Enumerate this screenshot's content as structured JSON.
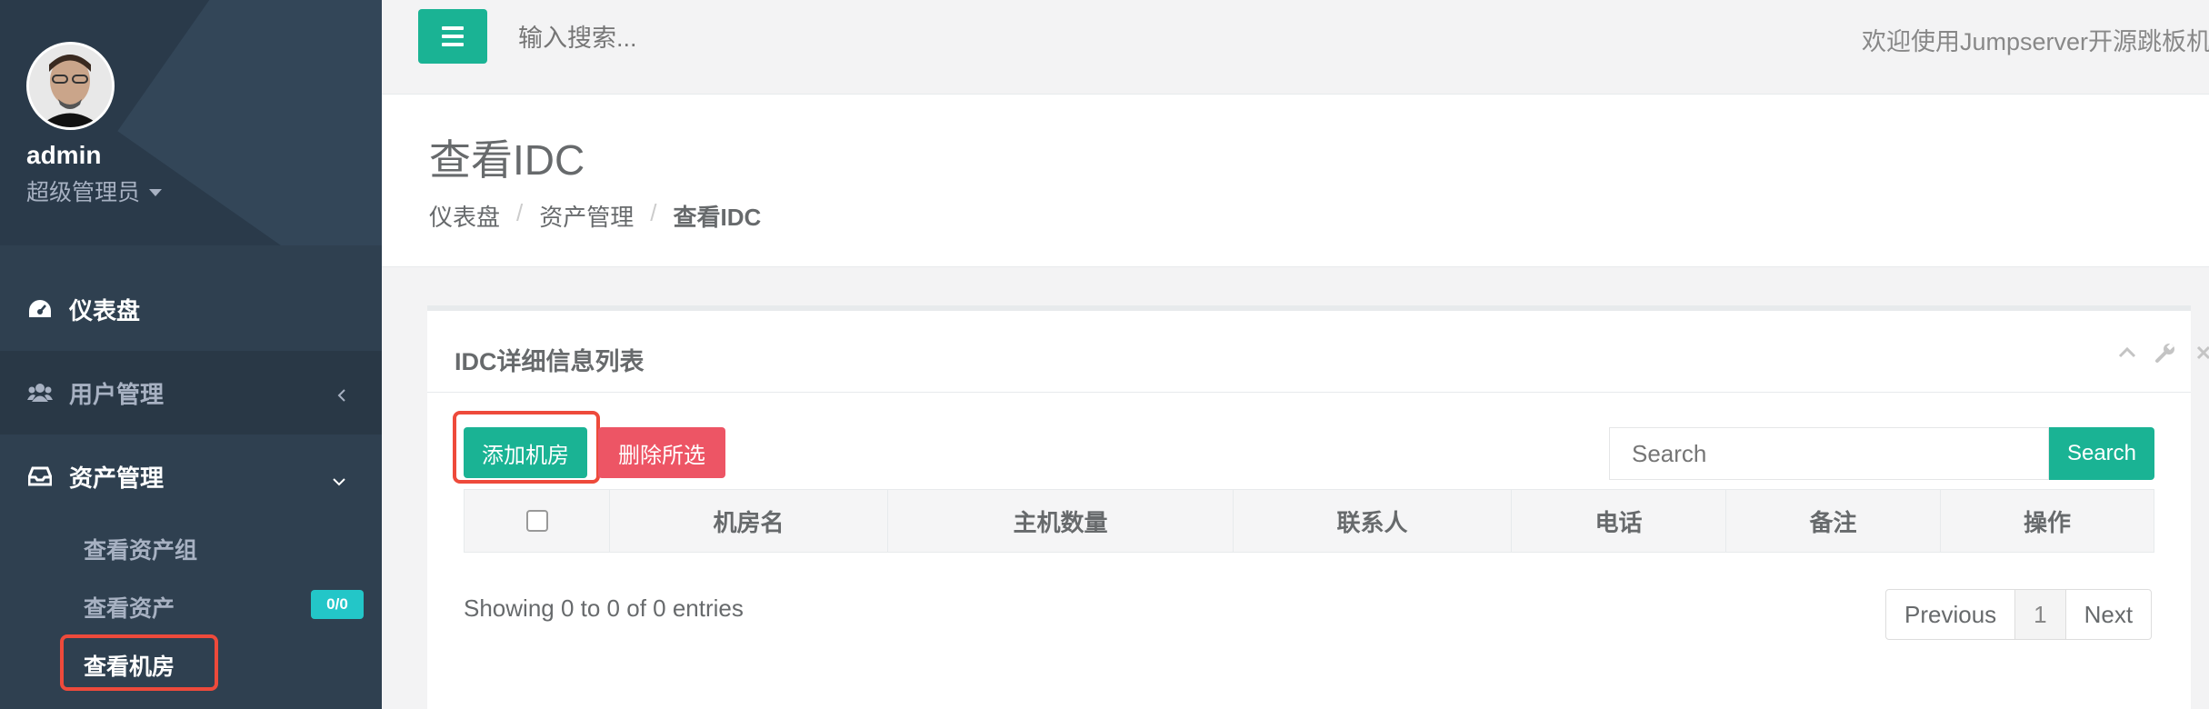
{
  "sidebar": {
    "profile": {
      "name": "admin",
      "role": "超级管理员"
    },
    "items": [
      {
        "label": "仪表盘",
        "icon": "dashboard-icon"
      },
      {
        "label": "用户管理",
        "icon": "users-icon"
      },
      {
        "label": "资产管理",
        "icon": "inbox-icon"
      }
    ],
    "sub_items": [
      {
        "label": "查看资产组"
      },
      {
        "label": "查看资产",
        "badge": "0/0"
      },
      {
        "label": "查看机房"
      }
    ]
  },
  "topbar": {
    "search_placeholder": "输入搜索...",
    "welcome": "欢迎使用Jumpserver开源跳板机系"
  },
  "heading": {
    "title": "查看IDC",
    "breadcrumb": [
      "仪表盘",
      "资产管理",
      "查看IDC"
    ]
  },
  "panel": {
    "title": "IDC详细信息列表",
    "add_button": "添加机房",
    "delete_button": "删除所选",
    "search_placeholder": "Search",
    "search_button": "Search",
    "columns": [
      "机房名",
      "主机数量",
      "联系人",
      "电话",
      "备注",
      "操作"
    ],
    "info": "Showing 0 to 0 of 0 entries",
    "pagination": {
      "prev": "Previous",
      "page": "1",
      "next": "Next"
    }
  },
  "colors": {
    "sidebar_bg": "#2f4050",
    "primary": "#1ab394",
    "danger": "#ed5565",
    "badge": "#23c6c8",
    "highlight": "#ee4a3b"
  }
}
